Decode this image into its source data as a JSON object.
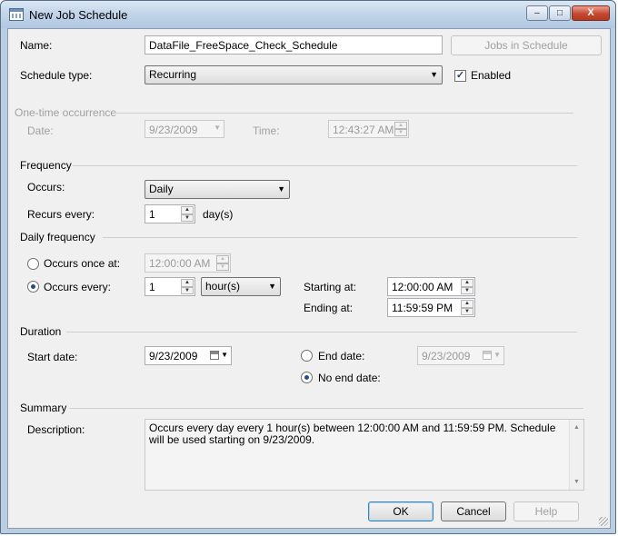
{
  "window": {
    "title": "New Job Schedule",
    "minimize": "–",
    "maximize": "□",
    "close": "X"
  },
  "name": {
    "label": "Name:",
    "value": "DataFile_FreeSpace_Check_Schedule"
  },
  "jobs_button": "Jobs in Schedule",
  "schedule_type": {
    "label": "Schedule type:",
    "value": "Recurring"
  },
  "enabled": {
    "label": "Enabled",
    "checked": "✓"
  },
  "one_time": {
    "section": "One-time occurrence",
    "date_label": "Date:",
    "date_value": "9/23/2009",
    "time_label": "Time:",
    "time_value": "12:43:27 AM"
  },
  "frequency": {
    "section": "Frequency",
    "occurs_label": "Occurs:",
    "occurs_value": "Daily",
    "recurs_label": "Recurs every:",
    "recurs_value": "1",
    "recurs_unit": "day(s)"
  },
  "daily": {
    "section": "Daily frequency",
    "once_label": "Occurs once at:",
    "once_value": "12:00:00 AM",
    "every_label": "Occurs every:",
    "every_value": "1",
    "every_unit": "hour(s)",
    "starting_label": "Starting at:",
    "starting_value": "12:00:00 AM",
    "ending_label": "Ending at:",
    "ending_value": "11:59:59 PM"
  },
  "duration": {
    "section": "Duration",
    "start_label": "Start date:",
    "start_value": "9/23/2009",
    "end_label": "End date:",
    "end_value": "9/23/2009",
    "no_end_label": "No end date:"
  },
  "summary": {
    "section": "Summary",
    "description_label": "Description:",
    "description_text": "Occurs every day every 1 hour(s) between 12:00:00 AM and 11:59:59 PM. Schedule will be used starting on 9/23/2009."
  },
  "buttons": {
    "ok": "OK",
    "cancel": "Cancel",
    "help": "Help"
  },
  "glyphs": {
    "dropdown": "▼",
    "up": "▲",
    "down": "▼"
  }
}
